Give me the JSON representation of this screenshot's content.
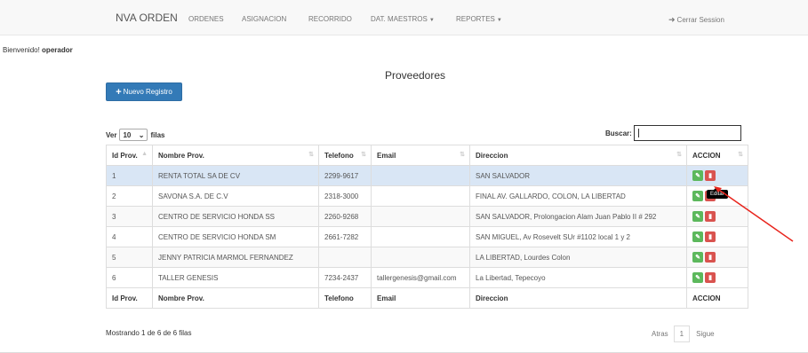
{
  "nav": {
    "brand": "NVA ORDEN",
    "items": [
      {
        "label": "ORDENES"
      },
      {
        "label": "ASIGNACION"
      },
      {
        "label": "RECORRIDO"
      },
      {
        "label": "DAT. MAESTROS"
      },
      {
        "label": "REPORTES"
      }
    ],
    "logout": "Cerrar Session"
  },
  "welcome": {
    "prefix": "Bienvenido!",
    "user": "operador"
  },
  "page": {
    "title": "Proveedores",
    "new_button": "Nuevo Registro"
  },
  "length": {
    "prefix": "Ver",
    "value": "10",
    "suffix": "filas"
  },
  "search": {
    "label": "Buscar:",
    "value": ""
  },
  "table": {
    "columns": [
      "Id Prov.",
      "Nombre Prov.",
      "Telefono",
      "Email",
      "Direccion",
      "ACCION"
    ],
    "rows": [
      {
        "id": "1",
        "nombre": "RENTA TOTAL SA DE CV",
        "telefono": "2299-9617",
        "email": "",
        "direccion": "SAN SALVADOR"
      },
      {
        "id": "2",
        "nombre": "SAVONA S.A. DE C.V",
        "telefono": "2318-3000",
        "email": "",
        "direccion": "FINAL AV. GALLARDO, COLON, LA LIBERTAD"
      },
      {
        "id": "3",
        "nombre": "CENTRO DE SERVICIO HONDA SS",
        "telefono": "2260-9268",
        "email": "",
        "direccion": "SAN SALVADOR, Prolongacion Alam Juan Pablo II # 292"
      },
      {
        "id": "4",
        "nombre": "CENTRO DE SERVICIO HONDA SM",
        "telefono": "2661-7282",
        "email": "",
        "direccion": "SAN MIGUEL, Av Rosevelt SUr #1102 local 1 y 2"
      },
      {
        "id": "5",
        "nombre": "JENNY PATRICIA MARMOL FERNANDEZ",
        "telefono": "",
        "email": "",
        "direccion": "LA LIBERTAD, Lourdes Colon"
      },
      {
        "id": "6",
        "nombre": "TALLER GENESIS",
        "telefono": "7234-2437",
        "email": "tallergenesis@gmail.com",
        "direccion": "La Libertad, Tepecoyo"
      }
    ]
  },
  "tooltip": "Editar",
  "footer": {
    "info": "Mostrando 1 de 6 de 6 filas",
    "prev": "Atras",
    "page": "1",
    "next": "Sigue"
  },
  "colors": {
    "primary": "#337ab7",
    "edit": "#5cb85c",
    "delete": "#d9534f",
    "selected_row": "#d9e6f5",
    "annotation": "#e8241c"
  },
  "icons": {
    "logout": "logout-icon",
    "plus": "plus-icon",
    "edit": "edit-icon",
    "delete": "trash-icon",
    "sort": "sort-icon"
  }
}
